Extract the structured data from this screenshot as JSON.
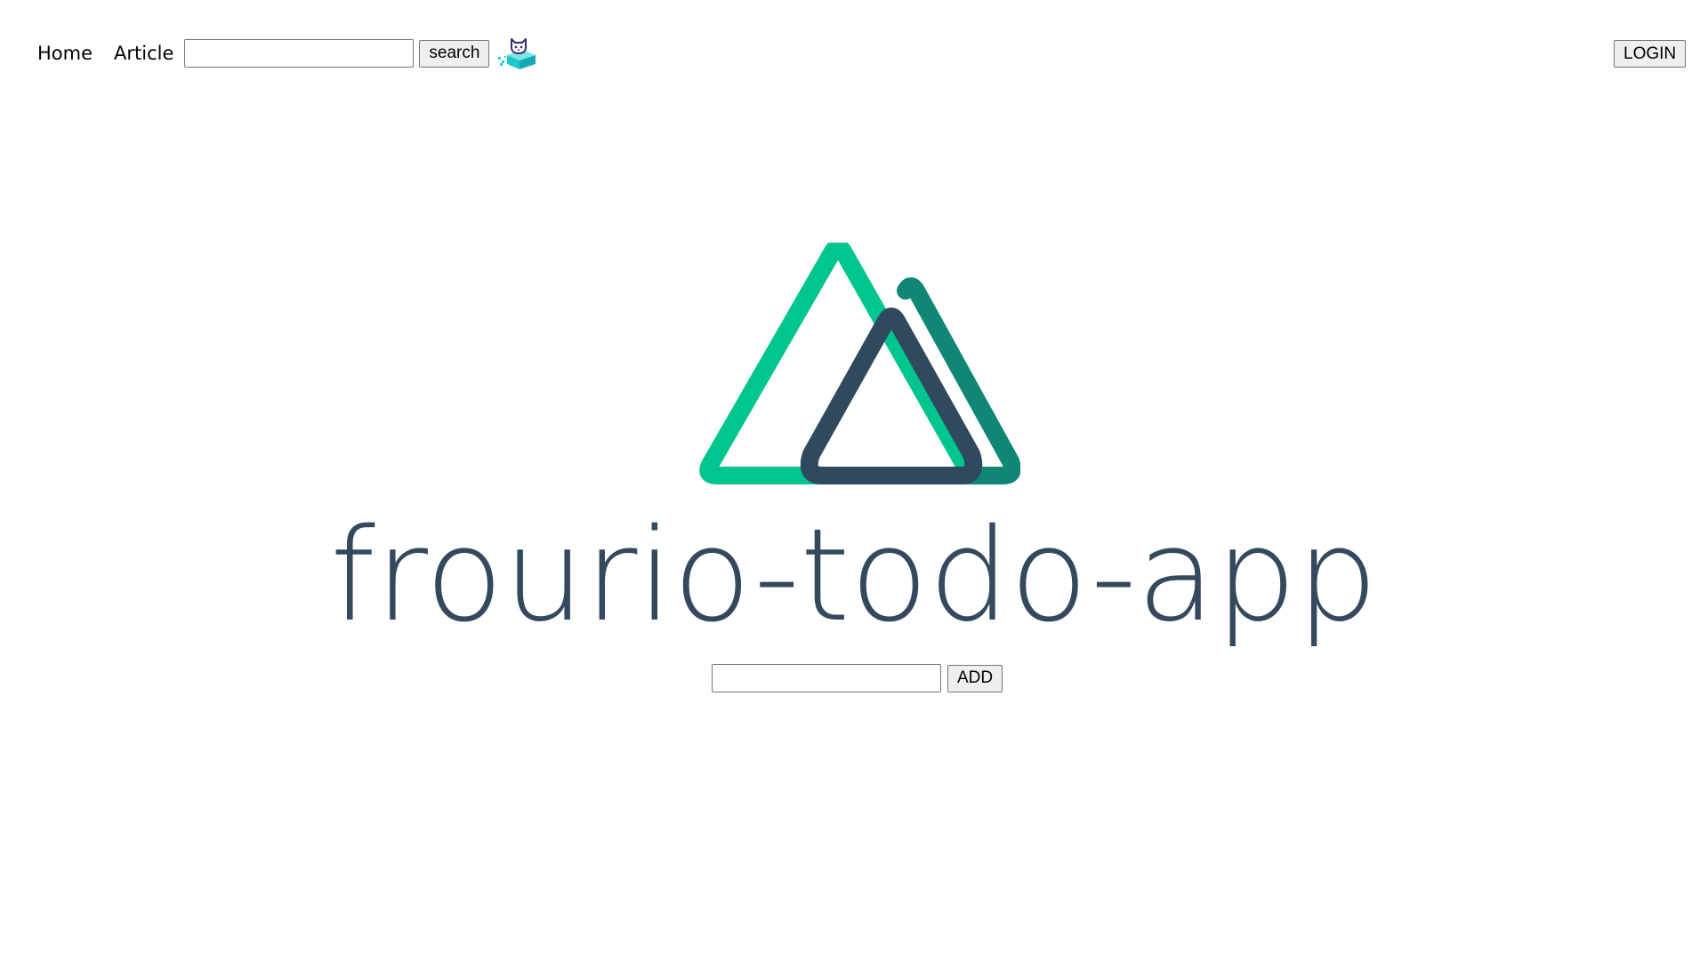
{
  "nav": {
    "home_label": "Home",
    "article_label": "Article",
    "search_placeholder": "",
    "search_value": "",
    "search_button_label": "search",
    "mascot_icon": "frourio-mascot-icon"
  },
  "auth": {
    "login_label": "LOGIN"
  },
  "hero": {
    "logo_icon": "nuxt-logo-icon",
    "title": "frourio-todo-app"
  },
  "todo_form": {
    "input_value": "",
    "input_placeholder": "",
    "add_button_label": "ADD"
  },
  "colors": {
    "logo_light_green": "#00c58e",
    "logo_dark_green": "#108775",
    "logo_navy": "#2f495e",
    "title_text": "#35495e"
  }
}
